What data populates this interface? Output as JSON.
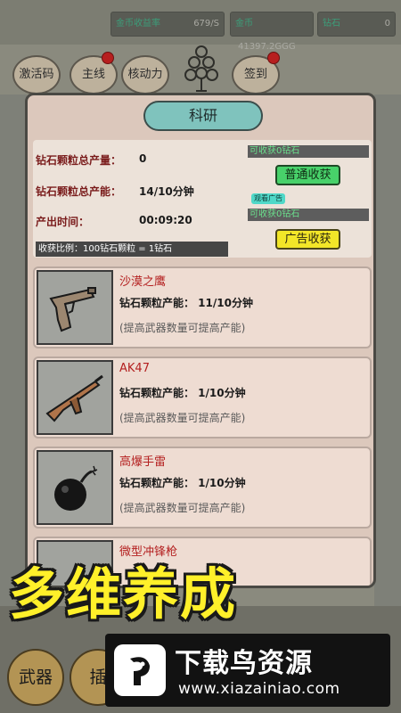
{
  "topbar": {
    "gold_rate_label": "金币收益率",
    "gold_rate_value": "679/S",
    "gold_label": "金币",
    "gold_value": "41397.2GGG",
    "diamond_label": "钻石",
    "diamond_value": "0"
  },
  "top_buttons": [
    "激活码",
    "主线",
    "核动力",
    "签到"
  ],
  "panel": {
    "title": "科研",
    "total_output_label": "钻石颗粒总产量：",
    "total_output_value": "0",
    "total_capacity_label": "钻石颗粒总产能：",
    "total_capacity_value": "14/10分钟",
    "time_label": "产出时间：",
    "time_value": "00:09:20",
    "ratio_text": "收获比例：100钻石颗粒 = 1钻石",
    "normal_harvest_label": "可收获0钻石",
    "normal_harvest_button": "普通收获",
    "ad_tag": "观看广告",
    "ad_harvest_label": "可收获0钻石",
    "ad_harvest_button": "广告收获"
  },
  "weapons": [
    {
      "name": "沙漠之鹰",
      "rate": "钻石颗粒产能：  11/10分钟",
      "hint": "(提高武器数量可提高产能)",
      "icon": "pistol-icon"
    },
    {
      "name": "AK47",
      "rate": "钻石颗粒产能：  1/10分钟",
      "hint": "(提高武器数量可提高产能)",
      "icon": "rifle-icon"
    },
    {
      "name": "高爆手雷",
      "rate": "钻石颗粒产能：  1/10分钟",
      "hint": "(提高武器数量可提高产能)",
      "icon": "bomb-icon"
    },
    {
      "name": "微型冲锋枪",
      "rate": "",
      "hint": "",
      "icon": "smg-icon"
    }
  ],
  "bottom_buttons": [
    "武器",
    "插"
  ],
  "overlay": {
    "promo_text": "多维养成",
    "watermark_title": "下载鸟资源",
    "watermark_url": "www.xiazainiao.com"
  },
  "colors": {
    "panel_bg": "#dcc8bc",
    "title_bg": "#7fc3bd",
    "harvest_green": "#48d16a",
    "ad_yellow": "#f2e628",
    "weapon_name_red": "#b42020"
  }
}
